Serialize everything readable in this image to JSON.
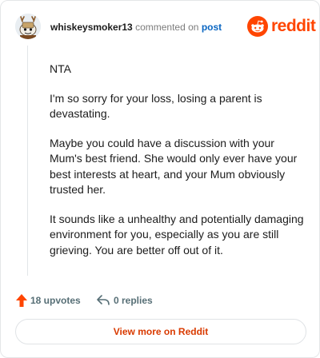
{
  "comment": {
    "username": "whiskeysmoker13",
    "action": "commented on",
    "link_label": "post",
    "paragraphs": [
      "NTA",
      "I'm so sorry for your loss, losing a parent is devastating.",
      "Maybe you could have a discussion with your Mum's best friend. She would only ever have your best interests at heart, and your Mum obviously trusted her.",
      "It sounds like a unhealthy and potentially damaging environment for you, especially as you are still grieving. You are better off out of it."
    ]
  },
  "brand": {
    "name": "reddit",
    "icon": "reddit-logo-icon",
    "color": "#ff4500"
  },
  "footer": {
    "upvotes": "18 upvotes",
    "upvote_icon": "upvote-arrow-icon",
    "replies": "0 replies",
    "reply_icon": "reply-arrow-icon"
  },
  "cta": {
    "label": "View more on Reddit",
    "color": "#d93a00"
  }
}
